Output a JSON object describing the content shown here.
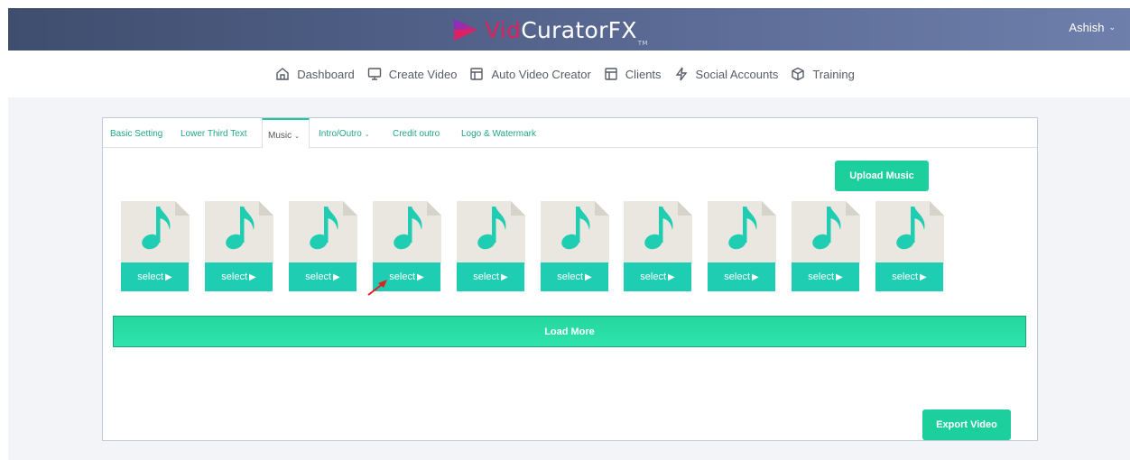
{
  "header": {
    "logo": {
      "vid": "Vid",
      "rest": "CuratorFX",
      "tm": "TM"
    },
    "user": {
      "name": "Ashish",
      "caret_icon": "chevron-down-icon"
    }
  },
  "nav": [
    {
      "label": "Dashboard",
      "icon": "home-icon"
    },
    {
      "label": "Create Video",
      "icon": "monitor-icon"
    },
    {
      "label": "Auto Video Creator",
      "icon": "layout-icon"
    },
    {
      "label": "Clients",
      "icon": "layout-icon"
    },
    {
      "label": "Social Accounts",
      "icon": "lightning-icon"
    },
    {
      "label": "Training",
      "icon": "box-icon"
    }
  ],
  "tabs": {
    "basic": "Basic Setting",
    "lower_third": "Lower Third Text",
    "music": "Music",
    "intro_outro": "Intro/Outro",
    "credit_outro": "Credit outro",
    "logo_watermark": "Logo & Watermark"
  },
  "music": {
    "upload_label": "Upload Music",
    "items": [
      {
        "label": "select"
      },
      {
        "label": "select"
      },
      {
        "label": "select"
      },
      {
        "label": "select"
      },
      {
        "label": "select"
      },
      {
        "label": "select"
      },
      {
        "label": "select"
      },
      {
        "label": "select"
      },
      {
        "label": "select"
      },
      {
        "label": "select"
      }
    ],
    "load_more_label": "Load More"
  },
  "footer": {
    "export_label": "Export Video"
  },
  "colors": {
    "accent": "#1ccf9d",
    "select": "#1fcdb3",
    "header_start": "#3f4d6e",
    "header_end": "#6e7fab",
    "logo_vid": "#d6245e"
  }
}
